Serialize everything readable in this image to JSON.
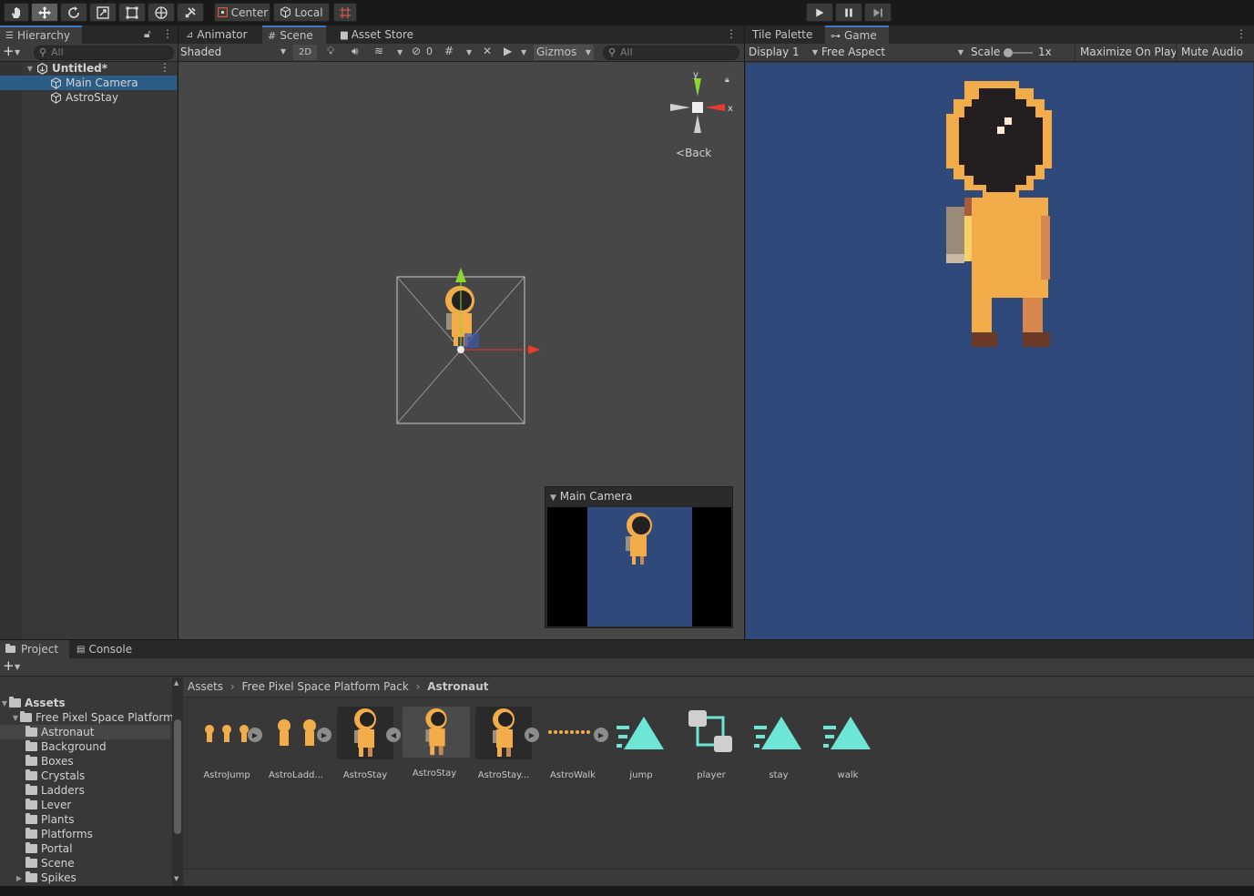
{
  "toolbar": {
    "center_label": "Center",
    "local_label": "Local"
  },
  "hierarchy": {
    "tab": "Hierarchy",
    "search_placeholder": "All",
    "scene_name": "Untitled*",
    "items": [
      {
        "label": "Main Camera",
        "selected": true
      },
      {
        "label": "AstroStay",
        "selected": false
      }
    ]
  },
  "scene_panel": {
    "tabs": [
      "Animator",
      "Scene",
      "Asset Store"
    ],
    "shading_mode": "Shaded",
    "mode_2d": "2D",
    "hidden_count": "0",
    "gizmos_label": "Gizmos",
    "search_placeholder": "All",
    "axis_y": "y",
    "axis_x": "x",
    "back_label": "Back",
    "camera_preview_title": "Main Camera"
  },
  "game_panel": {
    "tabs": [
      "Tile Palette",
      "Game"
    ],
    "display": "Display 1",
    "aspect": "Free Aspect",
    "scale_label": "Scale",
    "scale_value": "1x",
    "maximize_label": "Maximize On Play",
    "mute_label": "Mute Audio",
    "bg_color": "#2f4a7a"
  },
  "project": {
    "tabs": [
      "Project",
      "Console"
    ],
    "breadcrumb": [
      "Assets",
      "Free Pixel Space Platform Pack",
      "Astronaut"
    ],
    "tree_root": "Assets",
    "tree_pack": "Free Pixel Space Platform",
    "folders": [
      "Astronaut",
      "Background",
      "Boxes",
      "Crystals",
      "Ladders",
      "Lever",
      "Plants",
      "Platforms",
      "Portal",
      "Scene",
      "Spikes"
    ],
    "assets": [
      {
        "label": "AstroJump",
        "kind": "sprite-sheet"
      },
      {
        "label": "AstroLadd...",
        "kind": "sprite-sheet"
      },
      {
        "label": "AstroStay",
        "kind": "sprite"
      },
      {
        "label": "AstroStay",
        "kind": "sprite"
      },
      {
        "label": "AstroStay...",
        "kind": "sprite"
      },
      {
        "label": "AstroWalk",
        "kind": "sprite-sheet"
      },
      {
        "label": "jump",
        "kind": "anim"
      },
      {
        "label": "player",
        "kind": "controller"
      },
      {
        "label": "stay",
        "kind": "anim"
      },
      {
        "label": "walk",
        "kind": "anim"
      }
    ]
  },
  "colors": {
    "accent_blue": "#2c5d87",
    "suit_orange": "#f2ad4a",
    "anim_teal": "#6ee6d6"
  }
}
